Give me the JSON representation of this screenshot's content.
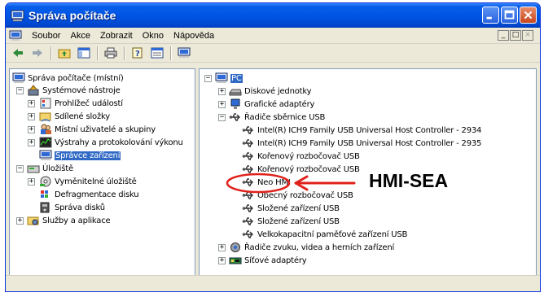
{
  "window": {
    "title": "Správa počítače"
  },
  "menu": [
    {
      "label": "Soubor"
    },
    {
      "label": "Akce"
    },
    {
      "label": "Zobrazit"
    },
    {
      "label": "Okno"
    },
    {
      "label": "Nápověda"
    }
  ],
  "mdi_controls": [
    "_",
    "□",
    "×"
  ],
  "toolbar": [
    "back-icon",
    "forward-icon",
    "up-folder-icon",
    "show-tree-icon",
    "print-icon",
    "help-icon",
    "properties-icon",
    "computer-icon"
  ],
  "left_tree": [
    {
      "label": "Správa počítače (místní)",
      "icon": "computer-icon"
    },
    {
      "label": "Systémové nástroje",
      "icon": "tools-icon"
    },
    {
      "label": "Prohlížeč událostí",
      "icon": "event-viewer-icon"
    },
    {
      "label": "Sdílené složky",
      "icon": "shared-folder-icon"
    },
    {
      "label": "Místní uživatelé a skupiny",
      "icon": "users-icon"
    },
    {
      "label": "Výstrahy a protokolování výkonu",
      "icon": "performance-icon"
    },
    {
      "label": "Správce zařízení",
      "icon": "device-manager-icon",
      "selected": true
    },
    {
      "label": "Úložiště",
      "icon": "storage-icon"
    },
    {
      "label": "Vyměnitelné úložiště",
      "icon": "removable-storage-icon"
    },
    {
      "label": "Defragmentace disku",
      "icon": "defrag-icon"
    },
    {
      "label": "Správa disků",
      "icon": "disk-management-icon"
    },
    {
      "label": "Služby a aplikace",
      "icon": "services-icon"
    }
  ],
  "right_tree": [
    {
      "label": "PC",
      "icon": "computer-icon",
      "selected": true
    },
    {
      "label": "Diskové jednotky",
      "icon": "disk-drive-icon"
    },
    {
      "label": "Grafické adaptéry",
      "icon": "display-adapter-icon"
    },
    {
      "label": "Řadiče sběrnice USB",
      "icon": "usb-icon"
    },
    {
      "label": "Intel(R) ICH9 Family USB Universal Host Controller - 2934",
      "icon": "usb-icon"
    },
    {
      "label": "Intel(R) ICH9 Family USB Universal Host Controller - 2935",
      "icon": "usb-icon"
    },
    {
      "label": "Kořenový rozbočovač USB",
      "icon": "usb-icon"
    },
    {
      "label": "Kořenový rozbočovač USB",
      "icon": "usb-icon"
    },
    {
      "label": "Neo HMI",
      "icon": "usb-icon"
    },
    {
      "label": "Obecný rozbočovač USB",
      "icon": "usb-icon"
    },
    {
      "label": "Složené zařízení USB",
      "icon": "usb-icon"
    },
    {
      "label": "Složené zařízení USB",
      "icon": "usb-icon"
    },
    {
      "label": "Velkokapacitní paměťové zařízení USB",
      "icon": "usb-icon"
    },
    {
      "label": "Řadiče zvuku, videa a herních zařízení",
      "icon": "sound-icon"
    },
    {
      "label": "Síťové adaptéry",
      "icon": "network-icon"
    }
  ],
  "annotation": {
    "text": "HMI-SEA",
    "color": "#e0201b"
  }
}
